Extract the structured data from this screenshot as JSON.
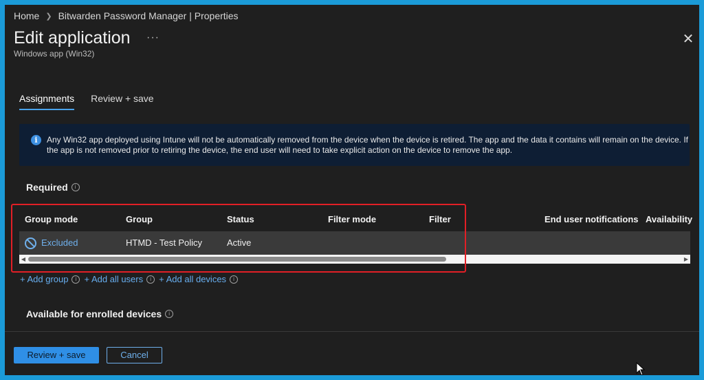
{
  "breadcrumb": {
    "home": "Home",
    "current": "Bitwarden Password Manager | Properties"
  },
  "header": {
    "title": "Edit application",
    "more": "···",
    "subtitle": "Windows app (Win32)",
    "close": "✕"
  },
  "tabs": [
    {
      "label": "Assignments",
      "active": true
    },
    {
      "label": "Review + save",
      "active": false
    }
  ],
  "info_banner": {
    "icon": "info-icon",
    "line1": "Any Win32 app deployed using Intune will not be automatically removed from the device when the device is retired. The app and the data it contains will remain on the device.",
    "line2": "If the app is not removed prior to retiring the device, the end user will need to take explicit action on the device to remove the app."
  },
  "required": {
    "heading": "Required",
    "columns": [
      "Group mode",
      "Group",
      "Status",
      "Filter mode",
      "Filter",
      "End user notifications",
      "Availability"
    ],
    "rows": [
      {
        "group_mode": "Excluded",
        "group": "HTMD - Test Policy",
        "status": "Active",
        "filter_mode": "",
        "filter": "",
        "notifications": "",
        "availability": ""
      }
    ]
  },
  "add_links": {
    "add_group": "+ Add group",
    "add_all_users": "+ Add all users",
    "add_all_devices": "+ Add all devices"
  },
  "available_enrolled": {
    "heading": "Available for enrolled devices"
  },
  "footer": {
    "review_save": "Review + save",
    "cancel": "Cancel"
  },
  "colors": {
    "accent": "#2f8fe6",
    "link": "#67adee",
    "highlight": "#e21f26",
    "banner_bg": "#0e1e34",
    "page_bg": "#1f1f1f"
  }
}
